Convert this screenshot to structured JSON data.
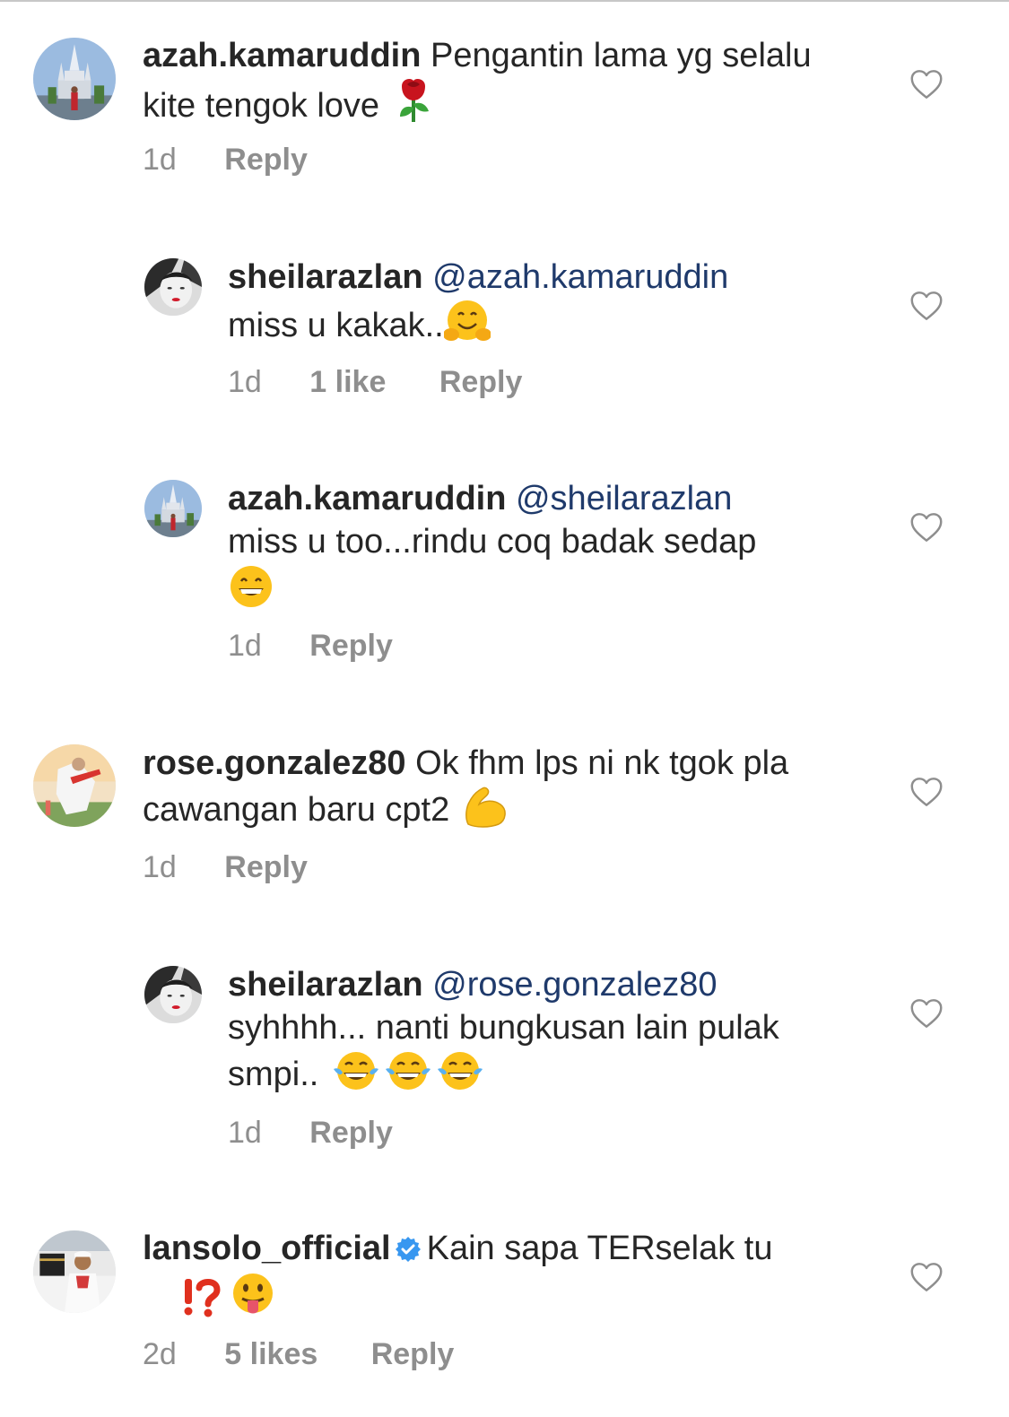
{
  "comments": [
    {
      "username": "azah.kamaruddin",
      "mention": "",
      "text": "Pengantin lama yg selalu kite tengok love",
      "time": "1d",
      "likes": "",
      "reply": "Reply",
      "emoji": [
        "rose-emoji"
      ]
    },
    {
      "username": "sheilarazlan",
      "mention": "@azah.kamaruddin",
      "text": "miss u kakak..",
      "time": "1d",
      "likes": "1 like",
      "reply": "Reply",
      "emoji": [
        "hugging-face-emoji"
      ]
    },
    {
      "username": "azah.kamaruddin",
      "mention": "@sheilarazlan",
      "text": "miss u too...rindu coq badak sedap",
      "time": "1d",
      "likes": "",
      "reply": "Reply",
      "emoji": [
        "grinning-face-emoji"
      ]
    },
    {
      "username": "rose.gonzalez80",
      "mention": "",
      "text": "Ok fhm lps ni nk tgok pla cawangan baru cpt2",
      "time": "1d",
      "likes": "",
      "reply": "Reply",
      "emoji": [
        "flexed-biceps-emoji"
      ]
    },
    {
      "username": "sheilarazlan",
      "mention": "@rose.gonzalez80",
      "text": "syhhhh... nanti bungkusan lain pulak smpi..",
      "time": "1d",
      "likes": "",
      "reply": "Reply",
      "emoji": [
        "tears-of-joy-emoji",
        "tears-of-joy-emoji",
        "tears-of-joy-emoji"
      ]
    },
    {
      "username": "lansolo_official",
      "mention": "",
      "text": "Kain sapa TERselak tu",
      "time": "2d",
      "likes": "5 likes",
      "reply": "Reply",
      "verified": true,
      "emoji": [
        "exclamation-question-mark-emoji",
        "face-with-tongue-emoji"
      ]
    }
  ],
  "colors": {
    "text": "#262626",
    "secondary": "#8e8e8e",
    "mention": "#1f3a6b",
    "verified": "#3897f0"
  }
}
